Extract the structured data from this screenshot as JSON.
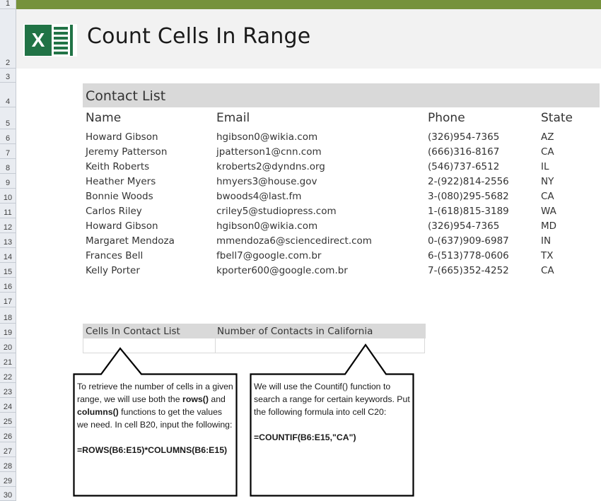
{
  "sheet": {
    "row_numbers": [
      "1",
      "2",
      "3",
      "4",
      "5",
      "6",
      "7",
      "8",
      "9",
      "10",
      "11",
      "12",
      "13",
      "14",
      "15",
      "16",
      "17",
      "18",
      "19",
      "20",
      "21",
      "22",
      "23",
      "24",
      "25",
      "26",
      "27",
      "28",
      "29",
      "30"
    ]
  },
  "header": {
    "icon": "excel-logo-icon",
    "icon_letter": "X",
    "title": "Count Cells In Range",
    "band_color": "#76923c"
  },
  "contact_list": {
    "title": "Contact List",
    "columns": [
      "Name",
      "Email",
      "Phone",
      "State"
    ],
    "rows": [
      {
        "name": "Howard Gibson",
        "email": "hgibson0@wikia.com",
        "phone": "(326)954-7365",
        "state": "AZ"
      },
      {
        "name": "Jeremy Patterson",
        "email": "jpatterson1@cnn.com",
        "phone": "(666)316-8167",
        "state": "CA"
      },
      {
        "name": "Keith Roberts",
        "email": "kroberts2@dyndns.org",
        "phone": "(546)737-6512",
        "state": "IL"
      },
      {
        "name": "Heather Myers",
        "email": "hmyers3@house.gov",
        "phone": "2-(922)814-2556",
        "state": "NY"
      },
      {
        "name": "Bonnie Woods",
        "email": "bwoods4@last.fm",
        "phone": "3-(080)295-5682",
        "state": "CA"
      },
      {
        "name": "Carlos Riley",
        "email": "criley5@studiopress.com",
        "phone": "1-(618)815-3189",
        "state": "WA"
      },
      {
        "name": "Howard Gibson",
        "email": "hgibson0@wikia.com",
        "phone": "(326)954-7365",
        "state": "MD"
      },
      {
        "name": "Margaret Mendoza",
        "email": "mmendoza6@sciencedirect.com",
        "phone": "0-(637)909-6987",
        "state": "IN"
      },
      {
        "name": "Frances Bell",
        "email": "fbell7@google.com.br",
        "phone": "6-(513)778-0606",
        "state": "TX"
      },
      {
        "name": "Kelly Porter",
        "email": "kporter600@google.com.br",
        "phone": "7-(665)352-4252",
        "state": "CA"
      }
    ]
  },
  "summary": {
    "headers": [
      "Cells In Contact List",
      "Number of Contacts in California"
    ],
    "values": [
      "",
      ""
    ]
  },
  "callouts": [
    {
      "intro": "To retrieve the number of cells in a given range, we will use both the ",
      "bold1": "rows()",
      "mid": " and ",
      "bold2": "columns()",
      "outro": " functions to get the values we need. In cell B20, input the following:",
      "formula": "=ROWS(B6:E15)*COLUMNS(B6:E15)"
    },
    {
      "text": "We will use the Countif() function to search a  range for certain keywords. Put the following formula into cell C20:",
      "formula": "=COUNTIF(B6:E15,\"CA\")"
    }
  ]
}
